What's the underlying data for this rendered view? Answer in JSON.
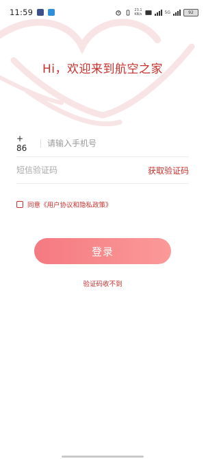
{
  "status_bar": {
    "time": "11:59",
    "net_speed": "23.1\nKB/s",
    "network_label": "5G",
    "battery": "92"
  },
  "colors": {
    "accent": "#c9302c",
    "button_gradient_start": "#f47a80",
    "button_gradient_end": "#fb9a98"
  },
  "header": {
    "welcome": "Hi，欢迎来到航空之家"
  },
  "form": {
    "country_code": "+ 86",
    "phone_placeholder": "请输入手机号",
    "code_placeholder": "短信验证码",
    "get_code_label": "获取验证码",
    "agreement_text": "同意《用户协议和隐私政策》",
    "login_label": "登录",
    "no_code_label": "验证码收不到"
  },
  "icons": {
    "notif_1": "app-notification-icon",
    "notif_2": "app-notification-icon",
    "alarm": "alarm-icon",
    "vibrate": "vibrate-icon",
    "signal": "signal-icon",
    "wifi": "wifi-icon",
    "battery": "battery-icon"
  }
}
